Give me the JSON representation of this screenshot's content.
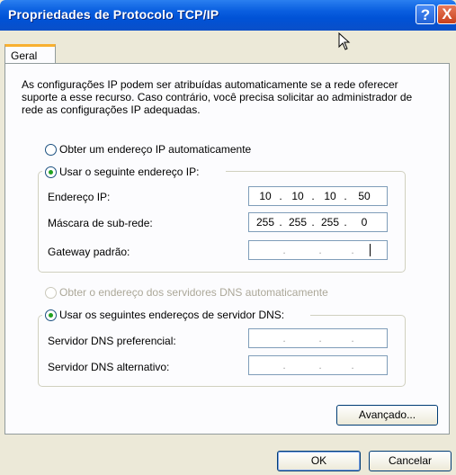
{
  "window": {
    "title": "Propriedades de Protocolo TCP/IP",
    "help_label": "?",
    "close_label": "X"
  },
  "tabs": [
    {
      "label": "Geral"
    }
  ],
  "description": "As configurações IP podem ser atribuídas automaticamente se a rede oferecer suporte a esse recurso. Caso contrário, você precisa solicitar ao administrador de rede as configurações IP adequadas.",
  "ip_mode": {
    "auto_label": "Obter um endereço IP automaticamente",
    "manual_label": "Usar o seguinte endereço IP:",
    "selected": "manual"
  },
  "ip_fields": [
    {
      "label": "Endereço IP:",
      "octets": [
        "10",
        "10",
        "10",
        "50"
      ]
    },
    {
      "label": "Máscara de sub-rede:",
      "octets": [
        "255",
        "255",
        "255",
        "0"
      ]
    },
    {
      "label": "Gateway padrão:",
      "octets": [
        "",
        "",
        "",
        ""
      ]
    }
  ],
  "dns_mode": {
    "auto_label": "Obter o endereço dos servidores DNS automaticamente",
    "manual_label": "Usar os seguintes endereços de servidor DNS:",
    "selected": "manual"
  },
  "dns_fields": [
    {
      "label": "Servidor DNS preferencial:",
      "octets": [
        "",
        "",
        "",
        ""
      ]
    },
    {
      "label": "Servidor DNS alternativo:",
      "octets": [
        "",
        "",
        "",
        ""
      ]
    }
  ],
  "buttons": {
    "advanced": "Avançado...",
    "ok": "OK",
    "cancel": "Cancelar"
  },
  "ip_separator": "."
}
